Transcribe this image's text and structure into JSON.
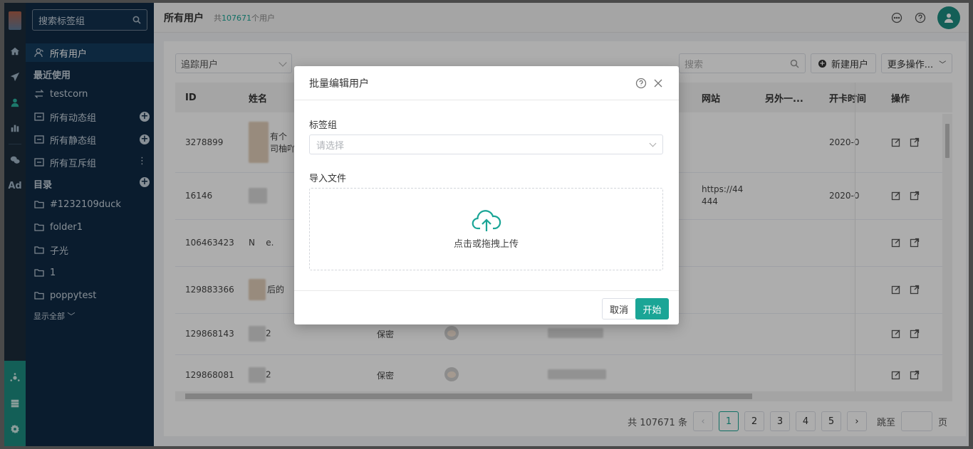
{
  "rail": {
    "items": [
      {
        "icon": "home-icon"
      },
      {
        "icon": "send-icon"
      },
      {
        "icon": "user-icon"
      },
      {
        "icon": "bar-chart-icon"
      },
      {
        "icon": "wechat-icon"
      },
      {
        "icon": "ad-icon",
        "text": "Ad"
      }
    ],
    "bottom": [
      {
        "icon": "hub-icon"
      },
      {
        "icon": "server-icon"
      },
      {
        "icon": "gear-icon"
      }
    ]
  },
  "sidebar": {
    "search_placeholder": "搜索标签组",
    "all_users": "所有用户",
    "recent_heading": "最近使用",
    "recent_item": "testcorn",
    "groups": [
      {
        "label": "所有动态组"
      },
      {
        "label": "所有静态组"
      },
      {
        "label": "所有互斥组"
      }
    ],
    "catalog_heading": "目录",
    "folders": [
      "#1232109duck",
      "folder1",
      "子光",
      "1",
      "poppytest"
    ],
    "show_all": "显示全部"
  },
  "topbar": {
    "title": "所有用户",
    "count_prefix": "共",
    "count_value": "107671",
    "count_suffix": "个用户"
  },
  "toolbar": {
    "filter_select": "追踪用户",
    "search_placeholder": "搜索",
    "new_user": "新建用户",
    "more_actions": "更多操作..."
  },
  "table": {
    "columns": [
      "ID",
      "姓名",
      "",
      "",
      "",
      "网站",
      "另外一...",
      "开卡时间",
      "操作"
    ],
    "rows": [
      {
        "id": "3278899",
        "name": "有个\n司柚吖",
        "gender": "",
        "website": "",
        "open": "2020-0"
      },
      {
        "id": "16146",
        "name": "",
        "gender": "",
        "website": "https://44\n444",
        "open": "2020-0"
      },
      {
        "id": "106463423",
        "name": "N    e.",
        "gender": "",
        "website": "",
        "open": ""
      },
      {
        "id": "129883366",
        "name": "后的",
        "gender": "",
        "website": "",
        "open": ""
      },
      {
        "id": "129868143",
        "name": "2",
        "gender": "保密",
        "website": "",
        "open": ""
      },
      {
        "id": "129868081",
        "name": "2",
        "gender": "保密",
        "website": "",
        "open": ""
      }
    ]
  },
  "pagination": {
    "total": "共 107671 条",
    "pages": [
      "1",
      "2",
      "3",
      "4",
      "5"
    ],
    "current": "1",
    "jump_label": "跳至",
    "page_unit": "页"
  },
  "modal": {
    "title": "批量编辑用户",
    "tag_group_label": "标签组",
    "tag_group_placeholder": "请选择",
    "import_label": "导入文件",
    "upload_text": "点击或拖拽上传",
    "cancel": "取消",
    "start": "开始"
  },
  "colors": {
    "accent": "#1aa596",
    "sidebar": "#0f2a44",
    "rail": "#1b2b3a"
  }
}
